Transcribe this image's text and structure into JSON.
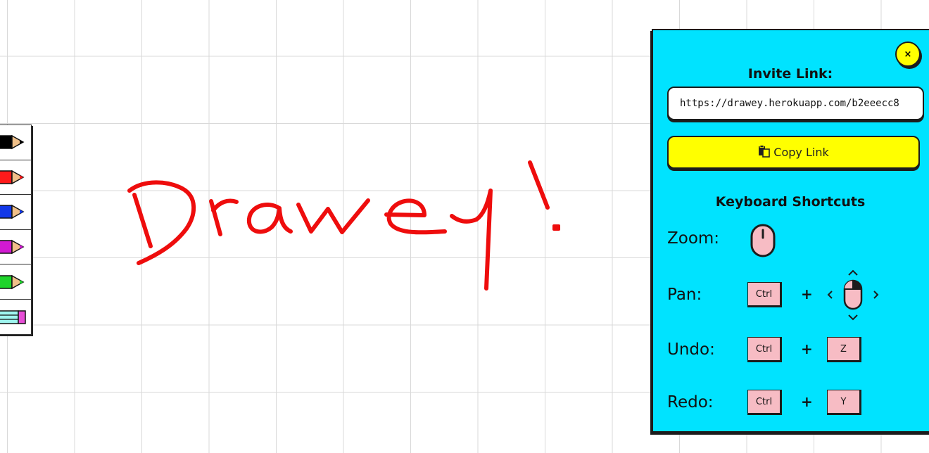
{
  "canvas": {
    "drawing_color": "#ee0d0d",
    "drawn_text": "Drawey!"
  },
  "toolbar": {
    "tools": [
      {
        "name": "black-pencil",
        "color": "#000000"
      },
      {
        "name": "red-pencil",
        "color": "#ff1a1a"
      },
      {
        "name": "blue-pencil",
        "color": "#1238e8"
      },
      {
        "name": "magenta-pencil",
        "color": "#d21ad2"
      },
      {
        "name": "green-pencil",
        "color": "#1fd42b"
      },
      {
        "name": "eraser",
        "color": "#9ff5ef"
      }
    ]
  },
  "panel": {
    "close_label": "×",
    "invite_title": "Invite Link:",
    "invite_url": "https://drawey.herokuapp.com/b2eeecc8",
    "copy_label": "Copy Link",
    "shortcuts_title": "Keyboard Shortcuts",
    "shortcuts": {
      "zoom": {
        "label": "Zoom:"
      },
      "pan": {
        "label": "Pan:",
        "key": "Ctrl",
        "plus": "+"
      },
      "undo": {
        "label": "Undo:",
        "key1": "Ctrl",
        "plus": "+",
        "key2": "Z"
      },
      "redo": {
        "label": "Redo:",
        "key1": "Ctrl",
        "plus": "+",
        "key2": "Y"
      }
    },
    "colors": {
      "background": "#00e3ff",
      "accent": "#ffff00",
      "key": "#f7bcc4"
    }
  }
}
